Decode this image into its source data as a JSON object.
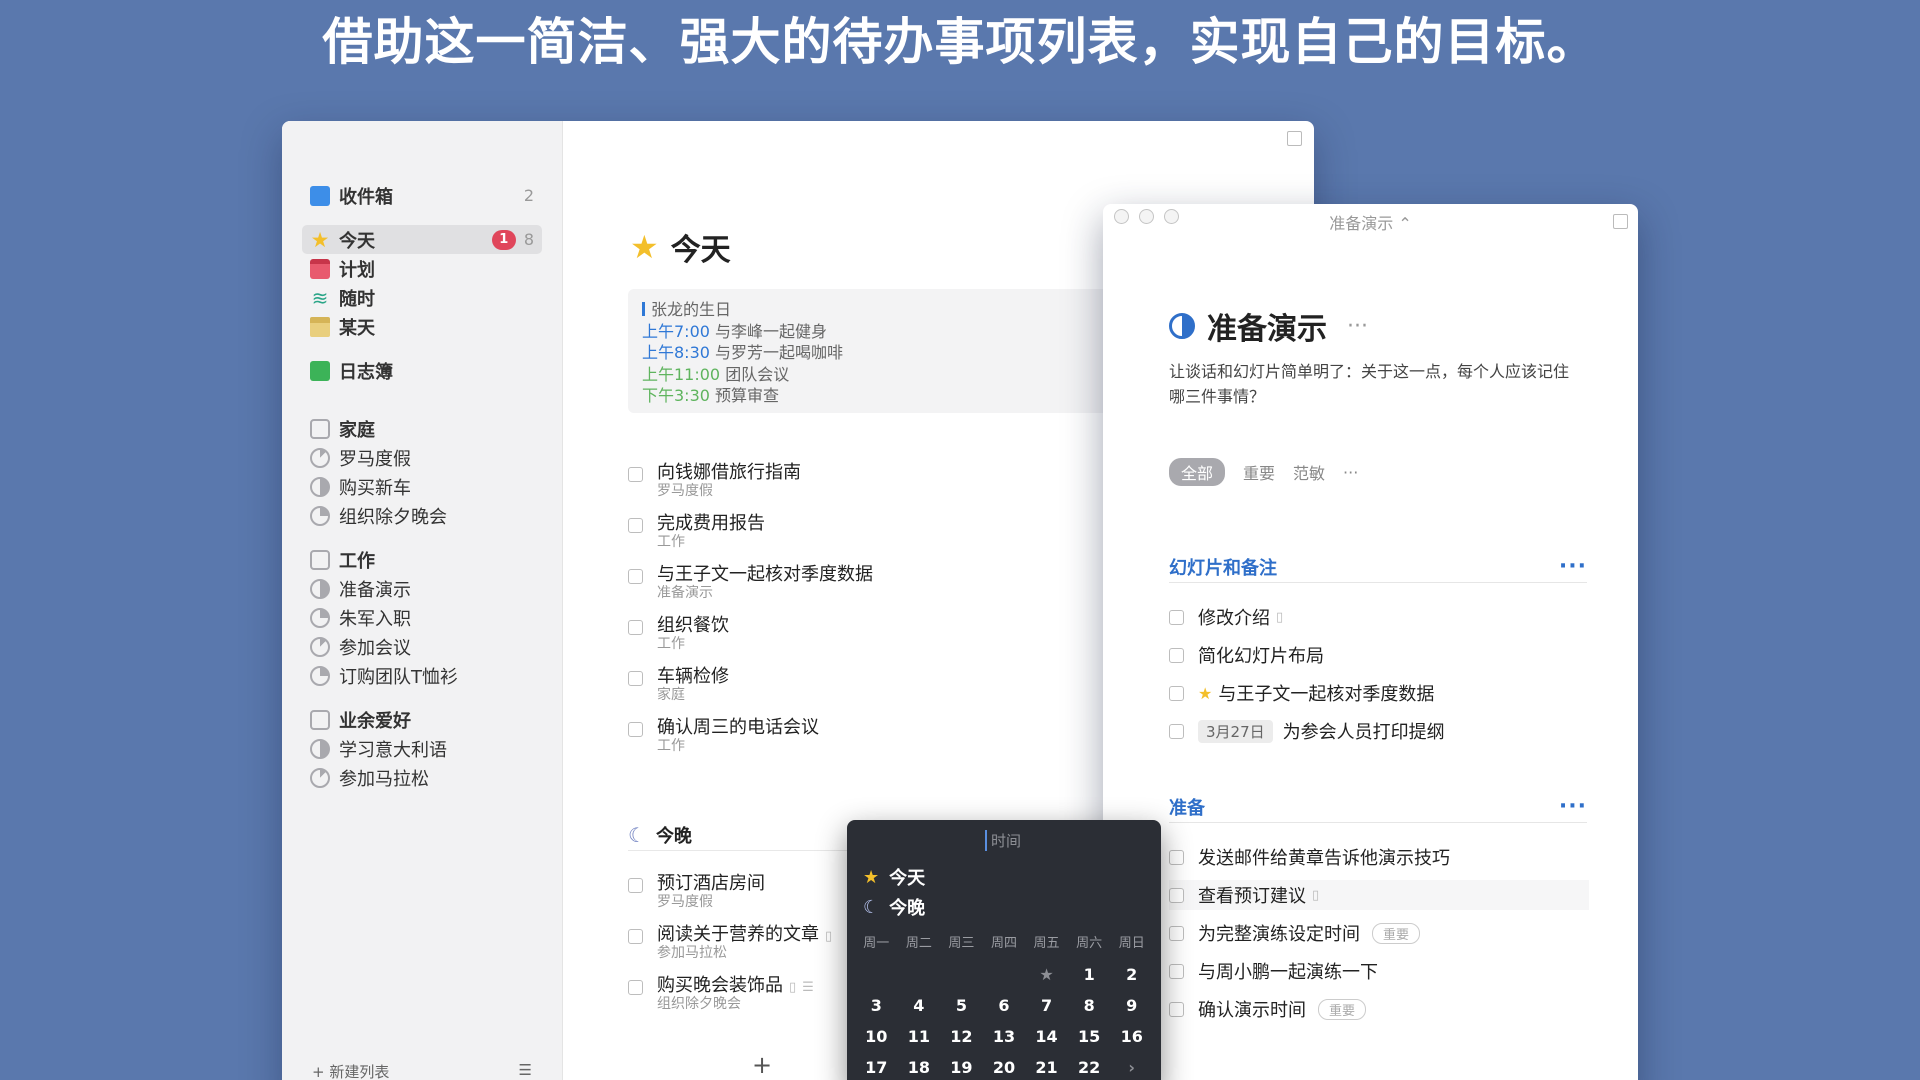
{
  "headline": "借助这一简洁、强大的待办事项列表，实现自己的目标。",
  "sidebar": {
    "inbox": {
      "label": "收件箱",
      "count": "2"
    },
    "today": {
      "label": "今天",
      "badge": "1",
      "count": "8"
    },
    "upcoming": {
      "label": "计划"
    },
    "anytime": {
      "label": "随时"
    },
    "someday": {
      "label": "某天"
    },
    "logbook": {
      "label": "日志簿"
    },
    "areas": [
      {
        "label": "家庭",
        "projects": [
          "罗马度假",
          "购买新车",
          "组织除夕晚会"
        ]
      },
      {
        "label": "工作",
        "projects": [
          "准备演示",
          "朱军入职",
          "参加会议",
          "订购团队T恤衫"
        ]
      },
      {
        "label": "业余爱好",
        "projects": [
          "学习意大利语",
          "参加马拉松"
        ]
      }
    ],
    "new_list": "新建列表"
  },
  "today_view": {
    "title": "今天",
    "events": [
      {
        "time": "",
        "title": "张龙的生日"
      },
      {
        "time": "上午7:00",
        "title": "与李峰一起健身"
      },
      {
        "time": "上午8:30",
        "title": "与罗芳一起喝咖啡"
      },
      {
        "time": "上午11:00",
        "title": "团队会议"
      },
      {
        "time": "下午3:30",
        "title": "预算审查"
      }
    ],
    "tasks": [
      {
        "title": "向钱娜借旅行指南",
        "project": "罗马度假"
      },
      {
        "title": "完成费用报告",
        "project": "工作"
      },
      {
        "title": "与王子文一起核对季度数据",
        "project": "准备演示"
      },
      {
        "title": "组织餐饮",
        "project": "工作"
      },
      {
        "title": "车辆检修",
        "project": "家庭"
      },
      {
        "title": "确认周三的电话会议",
        "project": "工作"
      }
    ],
    "evening_label": "今晚",
    "evening_tasks": [
      {
        "title": "预订酒店房间",
        "project": "罗马度假"
      },
      {
        "title": "阅读关于营养的文章",
        "project": "参加马拉松"
      },
      {
        "title": "购买晚会装饰品",
        "project": "组织除夕晚会"
      }
    ],
    "add": "+"
  },
  "project_window": {
    "bar_title": "准备演示 ⌃",
    "title": "准备演示",
    "notes": "让谈话和幻灯片简单明了：关于这一点，每个人应该记住哪三件事情？",
    "tags": [
      "全部",
      "重要",
      "范敏"
    ],
    "more": "···",
    "sections": [
      {
        "heading": "幻灯片和备注",
        "tasks": [
          "修改介绍",
          "简化幻灯片布局",
          "与王子文一起核对季度数据",
          "为参会人员打印提纲"
        ]
      },
      {
        "heading": "准备",
        "tasks": [
          "发送邮件给黄章告诉他演示技巧",
          "查看预订建议",
          "为完整演练设定时间",
          "与周小鹏一起演练一下",
          "确认演示时间"
        ]
      }
    ],
    "date_pill": "3月27日",
    "tag_important": "重要"
  },
  "picker": {
    "placeholder": "时间",
    "today": "今天",
    "evening": "今晚",
    "weekdays": [
      "周一",
      "周二",
      "周三",
      "周四",
      "周五",
      "周六",
      "周日"
    ],
    "rows": [
      [
        "",
        "",
        "",
        "",
        "★",
        "1",
        "2"
      ],
      [
        "3",
        "4",
        "5",
        "6",
        "7",
        "8",
        "9"
      ],
      [
        "10",
        "11",
        "12",
        "13",
        "14",
        "15",
        "16"
      ],
      [
        "17",
        "18",
        "19",
        "20",
        "21",
        "22",
        "›"
      ]
    ]
  },
  "colors": {
    "background": "#5a78ad",
    "accent": "#2f6fc9",
    "badge": "#e0465b",
    "star": "#f3bf2b"
  }
}
